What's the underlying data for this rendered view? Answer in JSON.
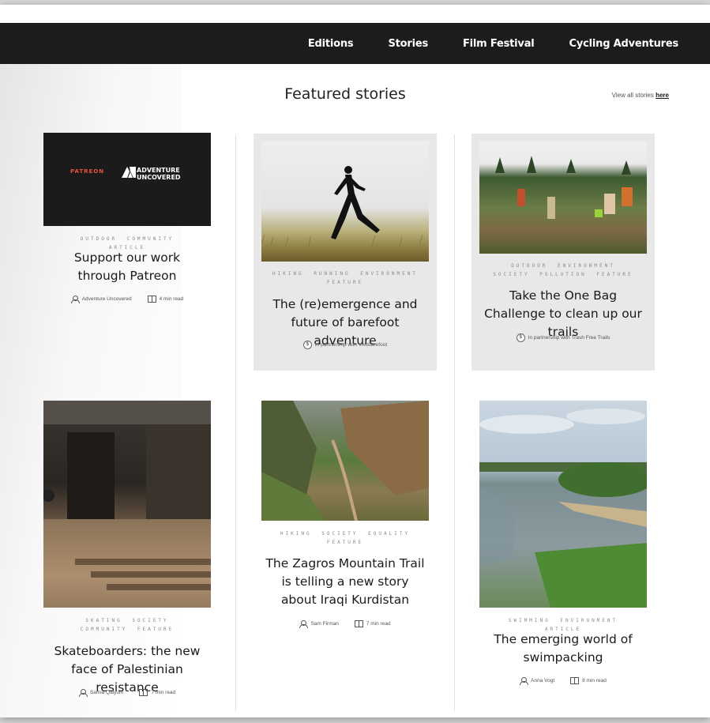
{
  "nav": {
    "items": [
      "Editions",
      "Stories",
      "Film Festival",
      "Cycling Adventures"
    ]
  },
  "section": {
    "title": "Featured stories",
    "view_all_prefix": "View all stories ",
    "view_all_link": "here"
  },
  "cards": [
    {
      "banner_left": "PATREON",
      "banner_right_1": "ADVENTURE",
      "banner_right_2": "UNCOVERED",
      "tags": [
        "OUTDOOR",
        "COMMUNITY",
        "ARTICLE"
      ],
      "title": "Support our work through Patreon",
      "author": "Adventure Uncovered",
      "read": "4 min read"
    },
    {
      "tags": [
        "HIKING",
        "RUNNING",
        "ENVIRONMENT",
        "FEATURE"
      ],
      "title": "The (re)emergence and future of barefoot adventure",
      "partner": "In partnership with Vivobarefoot"
    },
    {
      "tags": [
        "OUTDOOR",
        "ENVIRONMENT",
        "SOCIETY",
        "POLLUTION",
        "FEATURE"
      ],
      "title": "Take the One Bag Challenge to clean up our trails",
      "partner": "In partnership with Trash Free Trails"
    },
    {
      "tags": [
        "SKATING",
        "SOCIETY",
        "COMMUNITY",
        "FEATURE"
      ],
      "title": "Skateboarders: the new face of Palestinian resistance",
      "author": "Samia Qaiyum",
      "read": "7 min read"
    },
    {
      "tags": [
        "HIKING",
        "SOCIETY",
        "EQUALITY",
        "FEATURE"
      ],
      "title": "The Zagros Mountain Trail is telling a new story about Iraqi Kurdistan",
      "author": "Sam Firman",
      "read": "7 min read"
    },
    {
      "tags": [
        "SWIMMING",
        "ENVIRONMENT",
        "ARTICLE"
      ],
      "title": "The emerging world of swimpacking",
      "author": "Anna Vogt",
      "read": "8 min read"
    }
  ],
  "colors": {
    "nav_bg": "#1c1c1c",
    "card_grey": "#e8e8e8",
    "patreon_red": "#e8523a"
  }
}
